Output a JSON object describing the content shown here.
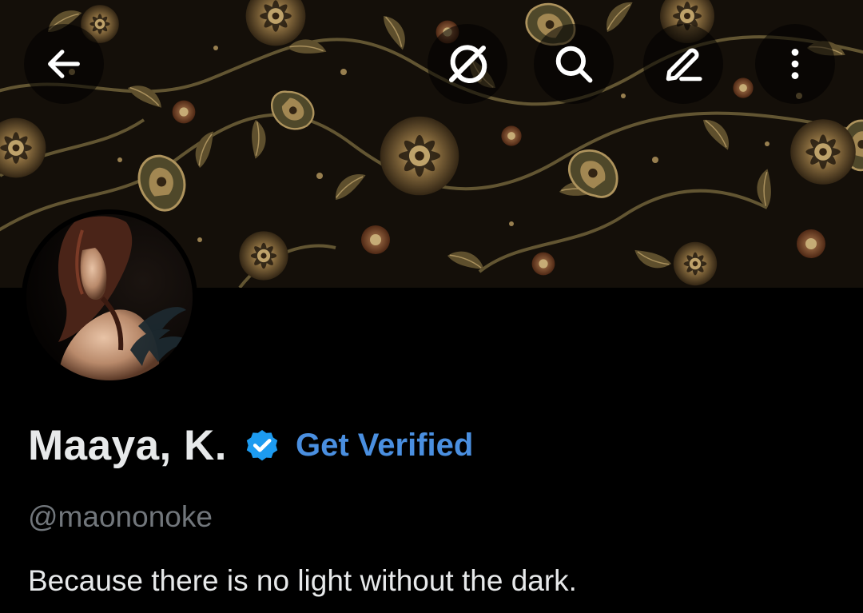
{
  "header": {
    "back_icon": "arrow-left-icon",
    "grok_icon": "grok-icon",
    "search_icon": "search-icon",
    "edit_icon": "pencil-icon",
    "more_icon": "more-vertical-icon"
  },
  "profile": {
    "display_name": "Maaya, K.",
    "verified_icon": "verified-badge-icon",
    "get_verified_label": "Get Verified",
    "handle": "@maononoke",
    "bio": "Because there is no light without the dark."
  },
  "colors": {
    "background": "#000000",
    "primary_text": "#e7e9ea",
    "secondary_text": "#71767b",
    "accent_blue": "#4a8fe0",
    "verified_blue": "#1d9bf0"
  }
}
